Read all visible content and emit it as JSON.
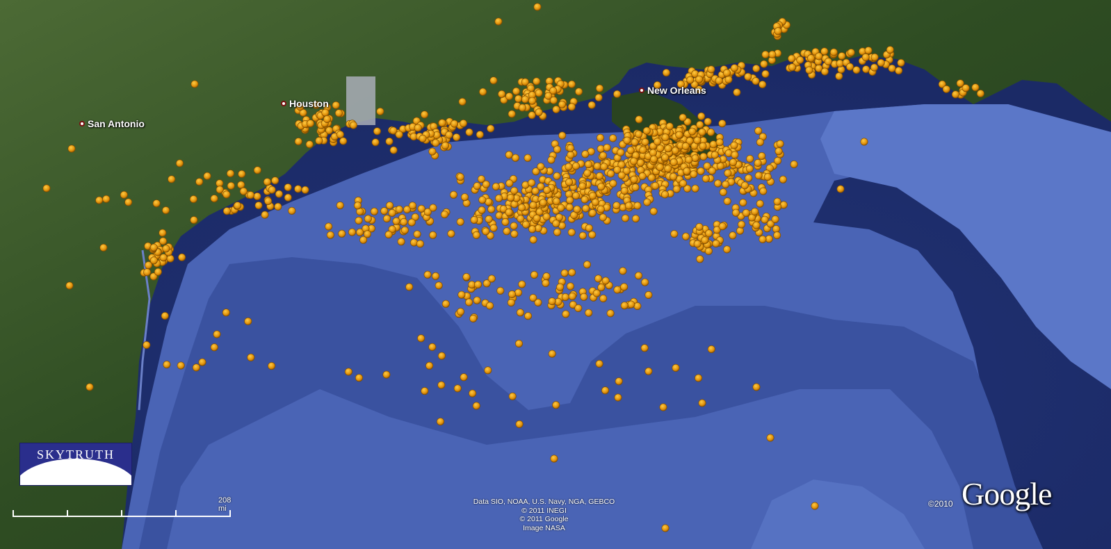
{
  "cities": [
    {
      "name": "San Antonio"
    },
    {
      "name": "Houston"
    },
    {
      "name": "New Orleans"
    }
  ],
  "scale": {
    "label": "208 mi"
  },
  "attribution": [
    "Data SIO, NOAA, U.S. Navy, NGA, GEBCO",
    "© 2011 INEGI",
    "© 2011 Google",
    "Image NASA"
  ],
  "logo": {
    "text": "SKYTRUTH"
  },
  "copyright": "©2010",
  "brand": "Google",
  "colors": {
    "land": "#3a5a2a",
    "shelf": "#4a66b8",
    "deep_ocean": "#1e2d6a",
    "marker": "#e0960a"
  },
  "icons": [
    "city-pin-icon",
    "incident-marker-icon"
  ]
}
